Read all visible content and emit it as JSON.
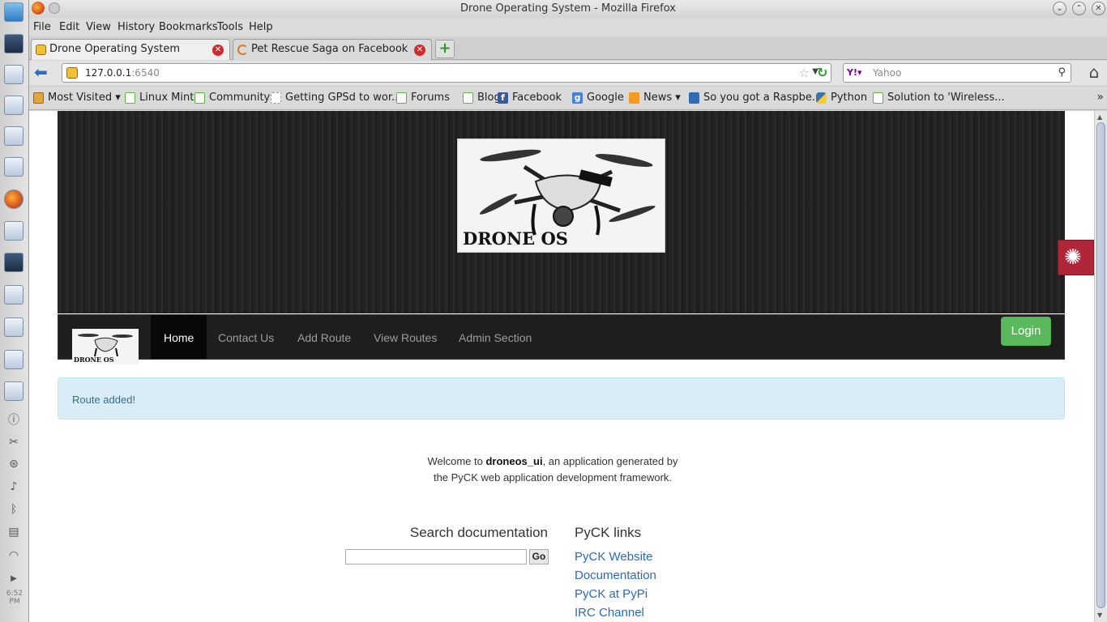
{
  "window": {
    "title": "Drone Operating System - Mozilla Firefox"
  },
  "menubar": {
    "file": "File",
    "edit": "Edit",
    "view": "View",
    "history": "History",
    "bookmarks": "Bookmarks",
    "tools": "Tools",
    "help": "Help"
  },
  "tabs": [
    {
      "label": "Drone Operating System",
      "active": true
    },
    {
      "label": "Pet Rescue Saga on Facebook",
      "active": false
    }
  ],
  "navbar": {
    "url_host": "127.0.0.1",
    "url_port": ":6540",
    "search_engine": "Yahoo"
  },
  "bookmarks": [
    {
      "label": "Most Visited",
      "icon": "folder-icon"
    },
    {
      "label": "Linux Mint",
      "icon": "mint-icon"
    },
    {
      "label": "Community",
      "icon": "mint-icon"
    },
    {
      "label": "Getting GPSd to wor...",
      "icon": "blank-page-icon"
    },
    {
      "label": "Forums",
      "icon": "mint-icon"
    },
    {
      "label": "Blog",
      "icon": "mint-icon"
    },
    {
      "label": "Facebook",
      "icon": "facebook-icon"
    },
    {
      "label": "Google",
      "icon": "google-icon"
    },
    {
      "label": "News",
      "icon": "rss-icon"
    },
    {
      "label": "So you got a Raspbe...",
      "icon": "raspberry-icon"
    },
    {
      "label": "Python",
      "icon": "python-icon"
    },
    {
      "label": "Solution to 'Wireless...",
      "icon": "mint-icon"
    }
  ],
  "site": {
    "logo_text": "DRONE OS",
    "nav": {
      "home": "Home",
      "contact": "Contact Us",
      "add_route": "Add Route",
      "view_routes": "View Routes",
      "admin": "Admin Section"
    },
    "login": "Login",
    "alert": "Route added!",
    "welcome": {
      "pre": "Welcome to ",
      "app": "droneos_ui",
      "post": ", an application generated by",
      "line2": "the PyCK web application development framework."
    },
    "search_title": "Search documentation",
    "search_go": "Go",
    "links_title": "PyCK links",
    "links": [
      "PyCK Website",
      "Documentation",
      "PyCK at PyPi",
      "IRC Channel"
    ]
  },
  "panel": {
    "clock": "6:52 PM"
  },
  "colors": {
    "alert_bg": "#d9edf7",
    "alert_text": "#31708f",
    "login_green": "#5cb85c",
    "link_blue": "#2a6ab8"
  }
}
